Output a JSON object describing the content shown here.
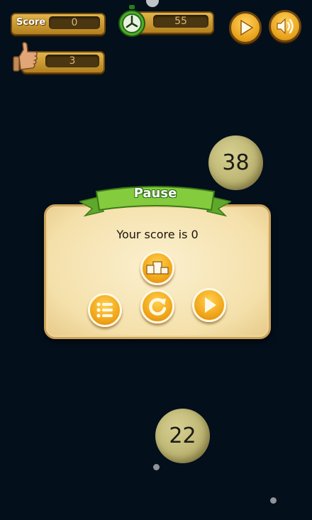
{
  "hud": {
    "score_label": "Score",
    "score_value": "0",
    "timer_value": "55",
    "lives_value": "3"
  },
  "balls": [
    {
      "number": "38"
    },
    {
      "number": "22"
    }
  ],
  "dialog": {
    "title": "Pause",
    "message": "Your score is 0"
  },
  "icons": {
    "play": "play-icon",
    "sound": "speaker-icon",
    "timer": "stopwatch-icon",
    "thumb": "thumbs-up-icon",
    "leaderboard": "podium-icon",
    "menu": "list-icon",
    "restart": "restart-icon",
    "resume": "play-icon"
  },
  "colors": {
    "background": "#030f1b",
    "accent": "#f0a317",
    "ribbon": "#7cc43a"
  }
}
